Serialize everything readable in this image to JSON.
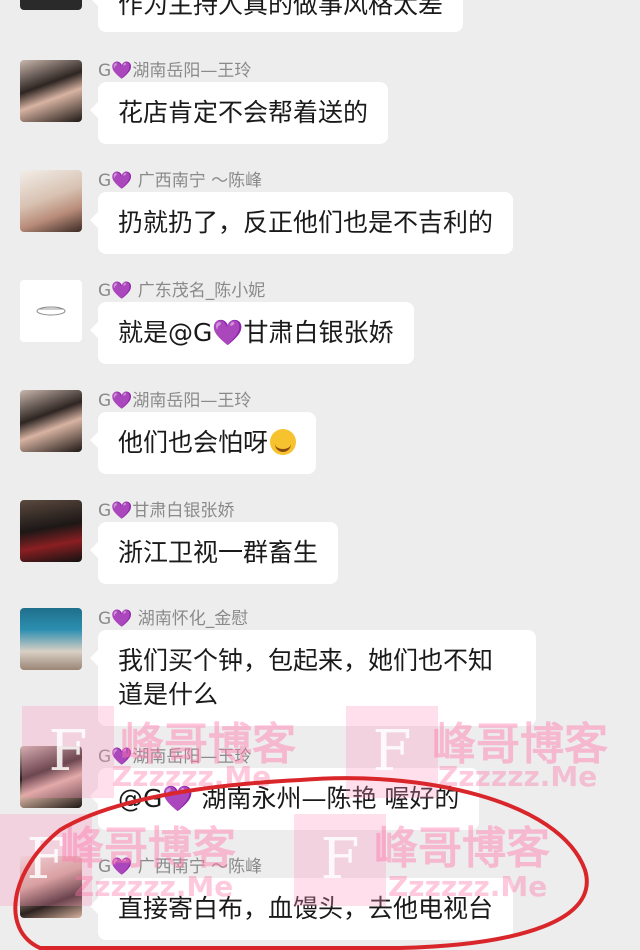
{
  "messages": [
    {
      "name": "",
      "text": "作为主持人真的做事风格太差",
      "avatar": "top-partial-avatar"
    },
    {
      "name_prefix": "G",
      "name_suffix": "湖南岳阳—王玲",
      "text": "花店肯定不会帮着送的",
      "avatar": "girl-avatar"
    },
    {
      "name_prefix": "G",
      "name_suffix": " 广西南宁 ～陈峰",
      "text": "扔就扔了，反正他们也是不吉利的",
      "avatar": "girl-hat-avatar"
    },
    {
      "name_prefix": "G",
      "name_suffix": " 广东茂名_陈小妮",
      "text_prefix": "就是@G",
      "text_suffix": "甘肃白银张娇",
      "avatar": "sketch-avatar"
    },
    {
      "name_prefix": "G",
      "name_suffix": "湖南岳阳—王玲",
      "text": "他们也会怕呀",
      "emoji": "laughing-crying-emoji",
      "avatar": "girl-avatar"
    },
    {
      "name_prefix": "G",
      "name_suffix": "甘肃白银张娇",
      "text": "浙江卫视一群畜生",
      "avatar": "graduation-group-avatar"
    },
    {
      "name_prefix": "G",
      "name_suffix": " 湖南怀化_金慰",
      "text_line1": "我们买个钟，包起来，她们也不知",
      "text_line2": "道是什么",
      "avatar": "storefront-avatar"
    },
    {
      "name_prefix": "G",
      "name_suffix": "湖南岳阳—王玲",
      "text_prefix": "@G",
      "text_suffix": " 湖南永州—陈艳 喔好的",
      "avatar": "girl-avatar"
    },
    {
      "name_prefix": "G",
      "name_suffix": " 广西南宁 ～陈峰",
      "text": "直接寄白布，血馒头，去他电视台",
      "avatar": "girl-hat-avatar"
    }
  ],
  "heart_glyph": "💜",
  "watermark": {
    "logo_letter": "F",
    "title": "峰哥博客",
    "url": "Zzzzzz.Me"
  },
  "colors": {
    "background": "#ededed",
    "bubble": "#ffffff",
    "name_text": "#8a8a8a",
    "heart": "#8a3cc8",
    "annotation_circle": "#d9262b"
  }
}
